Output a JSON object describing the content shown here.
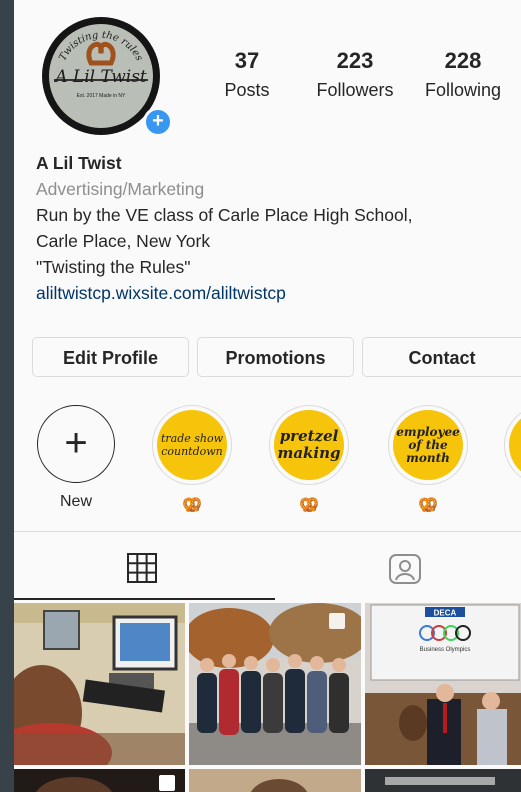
{
  "profile": {
    "avatar_text": "A Lil Twist",
    "avatar_arc_text": "Twisting the rules",
    "avatar_sub": "Est. 2017 Made in NY",
    "add_badge": "+",
    "stats": [
      {
        "value": "37",
        "label": "Posts"
      },
      {
        "value": "223",
        "label": "Followers"
      },
      {
        "value": "228",
        "label": "Following"
      }
    ],
    "name": "A Lil Twist",
    "category": "Advertising/Marketing",
    "bio_lines": [
      "Run by the VE class of Carle Place High School,",
      "Carle Place, New York",
      "\"Twisting the Rules\""
    ],
    "website": "aliltwistcp.wixsite.com/aliltwistcp"
  },
  "buttons": {
    "edit": "Edit Profile",
    "promotions": "Promotions",
    "contact": "Contact"
  },
  "highlights": [
    {
      "label": "New",
      "lines": [
        "+"
      ]
    },
    {
      "label": "🥨",
      "lines": [
        "trade show",
        "countdown"
      ]
    },
    {
      "label": "🥨",
      "lines": [
        "pretzel",
        "making"
      ]
    },
    {
      "label": "🥨",
      "lines": [
        "employee",
        "of the",
        "month"
      ]
    }
  ],
  "tabs": [
    {
      "icon": "grid-icon",
      "active": true
    },
    {
      "icon": "tagged-icon",
      "active": false
    }
  ],
  "grid_labels": {
    "deca": "DECA",
    "olympics": "Business Olympics"
  },
  "colors": {
    "background": "#37424a",
    "screen": "#fafafa",
    "accent_blue": "#3897f0",
    "highlight_yellow": "#f6c40b",
    "link": "#003569"
  }
}
